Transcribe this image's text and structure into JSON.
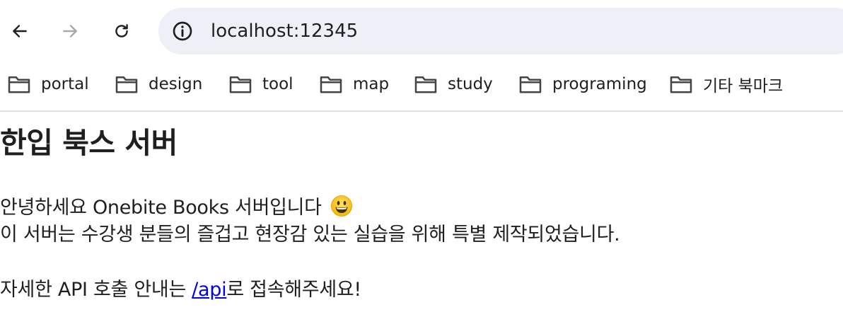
{
  "browser": {
    "back_icon": "arrow-left-icon",
    "forward_icon": "arrow-right-icon",
    "reload_icon": "reload-icon",
    "site_info_icon": "info-circle-icon",
    "url": "localhost:12345",
    "bookmarks": [
      {
        "label": "portal"
      },
      {
        "label": "design"
      },
      {
        "label": "tool"
      },
      {
        "label": "map"
      },
      {
        "label": "study"
      },
      {
        "label": "programing"
      },
      {
        "label": "기타 북마크"
      }
    ]
  },
  "page": {
    "heading": "한입 북스 서버",
    "greeting": "안녕하세요 Onebite Books 서버입니다",
    "greeting_emoji": "grinning-face-emoji",
    "description": "이 서버는 수강생 분들의 즐겁고 현장감 있는 실습을 위해 특별 제작되었습니다.",
    "api_prefix": "자세한 API 호출 안내는 ",
    "api_link": "/api",
    "api_suffix": "로 접속해주세요!"
  }
}
